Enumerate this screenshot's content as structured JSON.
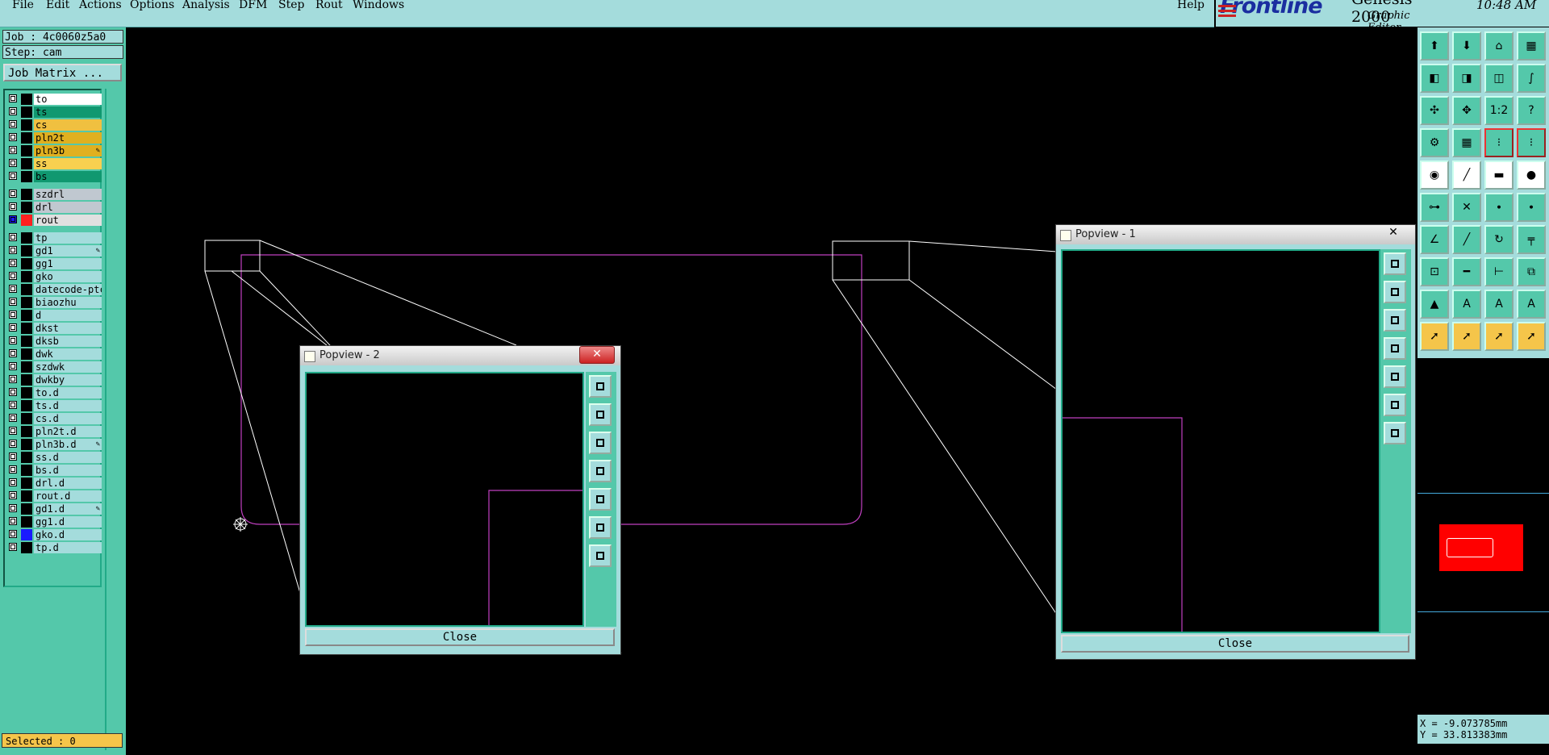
{
  "menu": {
    "items": [
      "File",
      "Edit",
      "Actions",
      "Options",
      "Analysis",
      "DFM",
      "Step",
      "Rout",
      "Windows"
    ],
    "help": "Help"
  },
  "brand": {
    "logo": "Frontline",
    "product": "Genesis 2000",
    "subtitle": "Graphic Editor"
  },
  "clock": "10:48 AM",
  "job": {
    "job_label": "Job : 4c0060z5a0",
    "step_label": "Step: cam",
    "matrix_button": "Job Matrix ..."
  },
  "layers": [
    {
      "name": "to",
      "color": "#ffffff",
      "swatch": "#000000"
    },
    {
      "name": "ts",
      "color": "#109870",
      "swatch": "#000000"
    },
    {
      "name": "cs",
      "color": "#f0c040",
      "swatch": "#000000"
    },
    {
      "name": "pln2t",
      "color": "#e0b020",
      "swatch": "#000000"
    },
    {
      "name": "pln3b",
      "color": "#e0b020",
      "swatch": "#000000",
      "affected": true
    },
    {
      "name": "ss",
      "color": "#f8d050",
      "swatch": "#000000"
    },
    {
      "name": "bs",
      "color": "#109870",
      "swatch": "#000000"
    },
    {
      "name": "szdrl",
      "color": "#c0c8d0",
      "swatch": "#000000"
    },
    {
      "name": "drl",
      "color": "#c0c8d0",
      "swatch": "#000000"
    },
    {
      "name": "rout",
      "color": "#e0e0e0",
      "swatch": "#ff2020",
      "active": true
    },
    {
      "name": "tp",
      "color": "#a4dcdc",
      "swatch": "#000000"
    },
    {
      "name": "gd1",
      "color": "#a4dcdc",
      "swatch": "#000000",
      "affected": true
    },
    {
      "name": "gg1",
      "color": "#a4dcdc",
      "swatch": "#000000"
    },
    {
      "name": "gko",
      "color": "#a4dcdc",
      "swatch": "#000000"
    },
    {
      "name": "datecode-ptc",
      "color": "#a4dcdc",
      "swatch": "#000000"
    },
    {
      "name": "biaozhu",
      "color": "#a4dcdc",
      "swatch": "#000000"
    },
    {
      "name": "d",
      "color": "#a4dcdc",
      "swatch": "#000000"
    },
    {
      "name": "dkst",
      "color": "#a4dcdc",
      "swatch": "#000000"
    },
    {
      "name": "dksb",
      "color": "#a4dcdc",
      "swatch": "#000000"
    },
    {
      "name": "dwk",
      "color": "#a4dcdc",
      "swatch": "#000000"
    },
    {
      "name": "szdwk",
      "color": "#a4dcdc",
      "swatch": "#000000"
    },
    {
      "name": "dwkby",
      "color": "#a4dcdc",
      "swatch": "#000000"
    },
    {
      "name": "to.d",
      "color": "#a4dcdc",
      "swatch": "#000000"
    },
    {
      "name": "ts.d",
      "color": "#a4dcdc",
      "swatch": "#000000"
    },
    {
      "name": "cs.d",
      "color": "#a4dcdc",
      "swatch": "#000000"
    },
    {
      "name": "pln2t.d",
      "color": "#a4dcdc",
      "swatch": "#000000"
    },
    {
      "name": "pln3b.d",
      "color": "#a4dcdc",
      "swatch": "#000000",
      "affected": true
    },
    {
      "name": "ss.d",
      "color": "#a4dcdc",
      "swatch": "#000000"
    },
    {
      "name": "bs.d",
      "color": "#a4dcdc",
      "swatch": "#000000"
    },
    {
      "name": "drl.d",
      "color": "#a4dcdc",
      "swatch": "#000000"
    },
    {
      "name": "rout.d",
      "color": "#a4dcdc",
      "swatch": "#000000"
    },
    {
      "name": "gd1.d",
      "color": "#a4dcdc",
      "swatch": "#000000",
      "affected": true
    },
    {
      "name": "gg1.d",
      "color": "#a4dcdc",
      "swatch": "#000000"
    },
    {
      "name": "gko.d",
      "color": "#a4dcdc",
      "swatch": "#1a1aff"
    },
    {
      "name": "tp.d",
      "color": "#a4dcdc",
      "swatch": "#000000"
    }
  ],
  "status": {
    "selected": "Selected : 0"
  },
  "coords": {
    "x": "X = -9.073785mm",
    "y": "Y = 33.813383mm"
  },
  "popview2": {
    "title": "Popview - 2",
    "close_x": "✕",
    "close_button": "Close"
  },
  "popview1": {
    "title": "Popview - 1",
    "close_x": "✕",
    "close_button": "Close"
  },
  "colors": {
    "rout_outline": "#c040c0",
    "panel_teal": "#54c8aa",
    "panel_light": "#a4dcdc"
  },
  "tools": [
    "zoom-home-icon",
    "zoom-page-icon",
    "zoom-home2-icon",
    "zoom-fit-icon",
    "pan-left-icon",
    "pan-right-icon",
    "pan-center-icon",
    "pan-s-icon",
    "zoom-in-icon",
    "zoom-out-icon",
    "scale-1-2-icon",
    "help-icon",
    "measure-icon",
    "grid-icon",
    "snap-red-icon",
    "snap-red2-icon",
    "pad-icon",
    "line-icon",
    "ruler-icon",
    "circle-icon",
    "connect-icon",
    "cross-icon",
    "point-icon",
    "point2-icon",
    "angle-icon",
    "diag-icon",
    "arc-icon",
    "route-icon",
    "pad-red-icon",
    "dash-icon",
    "measure-h-icon",
    "swap-icon",
    "tri-icon",
    "a-icon",
    "a-fill-icon",
    "a2-icon",
    "select-arrow-icon",
    "select-arrow2-icon",
    "select-move-icon",
    "select-multi-icon"
  ]
}
